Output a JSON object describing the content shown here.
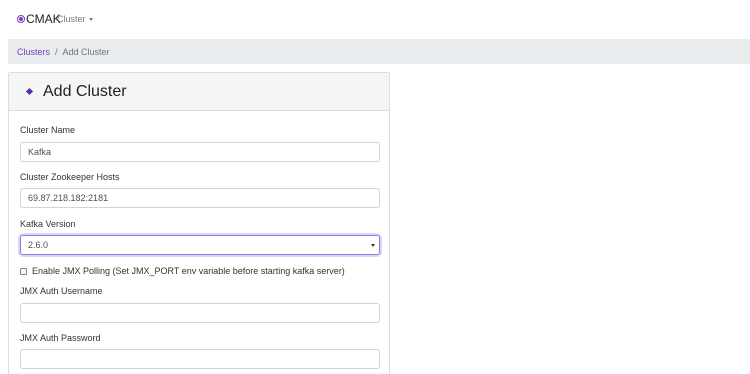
{
  "navbar": {
    "brand": "CMAK",
    "brand_icon": "cmak-logo-icon",
    "dropdown_label": "Cluster"
  },
  "breadcrumb": {
    "link": "Clusters",
    "separator": "/",
    "current": "Add Cluster"
  },
  "card": {
    "title": "Add Cluster",
    "header_icon": "diamond-icon"
  },
  "form": {
    "cluster_name": {
      "label": "Cluster Name",
      "value": "Kafka"
    },
    "zk_hosts": {
      "label": "Cluster Zookeeper Hosts",
      "value": "69.87.218.182:2181"
    },
    "kafka_version": {
      "label": "Kafka Version",
      "value": "2.6.0"
    },
    "jmx_polling": {
      "label": "Enable JMX Polling (Set JMX_PORT env variable before starting kafka server)",
      "checked": false
    },
    "jmx_user": {
      "label": "JMX Auth Username",
      "value": ""
    },
    "jmx_pass": {
      "label": "JMX Auth Password",
      "value": ""
    }
  },
  "colors": {
    "accent": "#6f42c1",
    "breadcrumb_bg": "#e9ecef",
    "card_header_bg": "#f5f5f5"
  }
}
